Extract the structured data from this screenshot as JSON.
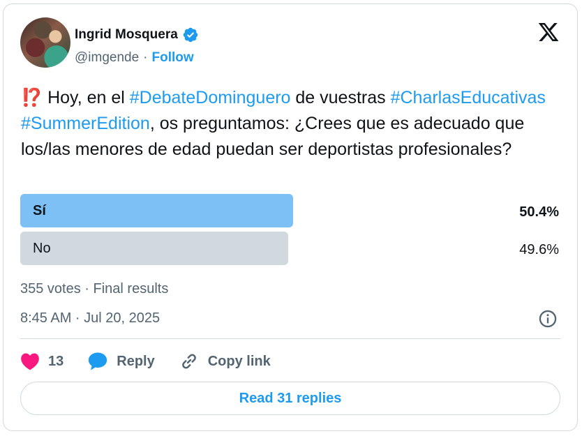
{
  "author": {
    "name": "Ingrid Mosquera",
    "handle": "@imgende",
    "separator": "·",
    "follow_label": "Follow"
  },
  "tweet": {
    "emoji": "⁉️",
    "text_1": " Hoy, en el ",
    "tag_1": "#DebateDominguero",
    "text_2": " de vuestras ",
    "tag_2": "#CharlasEducativas",
    "text_3": " ",
    "tag_3": "#SummerEdition",
    "text_4": ", os preguntamos: ¿Crees que es adecuado que los/las menores de edad puedan ser deportistas profesionales?"
  },
  "poll": {
    "options": [
      {
        "label": "Sí",
        "percent": "50.4%",
        "fraction": 0.504,
        "winner": true
      },
      {
        "label": "No",
        "percent": "49.6%",
        "fraction": 0.496,
        "winner": false
      }
    ],
    "summary": "355 votes · Final results"
  },
  "timestamp": "8:45 AM · Jul 20, 2025",
  "actions": {
    "like_count": "13",
    "reply_label": "Reply",
    "copy_label": "Copy link"
  },
  "read_replies_label": "Read 31 replies",
  "colors": {
    "accent": "#1d9bf0",
    "winner_bar": "#7cc0f5",
    "other_bar": "#cfd9de",
    "like": "#f91880"
  }
}
